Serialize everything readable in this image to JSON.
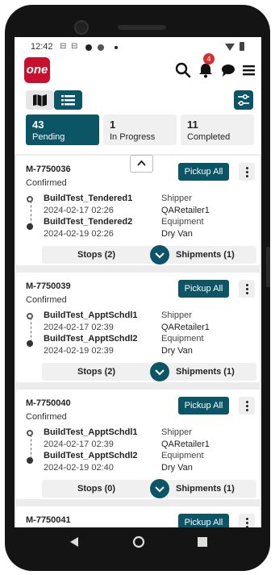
{
  "status_bar": {
    "time": "12:42",
    "icons": [
      "notification-s-icon",
      "notification-s-icon",
      "dot-icon",
      "settings-icon",
      "dot-small-icon",
      "wifi-icon",
      "battery-icon"
    ]
  },
  "app_bar": {
    "logo_text": "one",
    "notification_count": "4"
  },
  "tabs": [
    {
      "count": "43",
      "label": "Pending"
    },
    {
      "count": "1",
      "label": "In Progress"
    },
    {
      "count": "11",
      "label": "Completed"
    }
  ],
  "cards": [
    {
      "id": "M-7750036",
      "status": "Confirmed",
      "button": "Pickup All",
      "stop1_name": "BuildTest_Tendered1",
      "stop1_date": "2024-02-17 02:26",
      "stop2_name": "BuildTest_Tendered2",
      "stop2_date": "2024-02-19 02:26",
      "shipper_label": "Shipper",
      "shipper": "QARetailer1",
      "equipment_label": "Equipment",
      "equipment": "Dry Van",
      "stops": "Stops (2)",
      "shipments": "Shipments (1)"
    },
    {
      "id": "M-7750039",
      "status": "Confirmed",
      "button": "Pickup All",
      "stop1_name": "BuildTest_ApptSchdl1",
      "stop1_date": "2024-02-17 02:39",
      "stop2_name": "BuildTest_ApptSchdl2",
      "stop2_date": "2024-02-19 02:39",
      "shipper_label": "Shipper",
      "shipper": "QARetailer1",
      "equipment_label": "Equipment",
      "equipment": "Dry Van",
      "stops": "Stops (2)",
      "shipments": "Shipments (1)"
    },
    {
      "id": "M-7750040",
      "status": "Confirmed",
      "button": "Pickup All",
      "stop1_name": "BuildTest_ApptSchdl1",
      "stop1_date": "2024-02-17 02:39",
      "stop2_name": "BuildTest_ApptSchdl2",
      "stop2_date": "2024-02-19 02:40",
      "shipper_label": "Shipper",
      "shipper": "QARetailer1",
      "equipment_label": "Equipment",
      "equipment": "Dry Van",
      "stops": "Stops (0)",
      "shipments": "Shipments (1)"
    },
    {
      "id": "M-7750041",
      "button": "Pickup All"
    }
  ],
  "colors": {
    "accent": "#0b5566",
    "brand": "#c8102e",
    "badge": "#d32f2f"
  }
}
